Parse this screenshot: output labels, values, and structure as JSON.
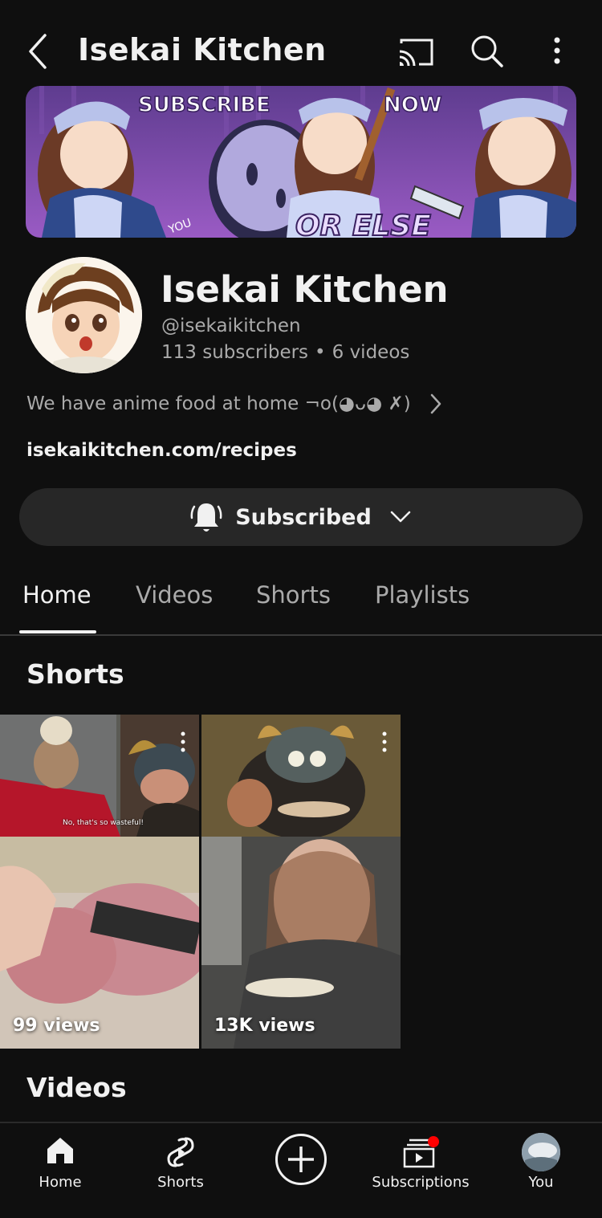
{
  "header": {
    "title": "Isekai Kitchen",
    "icons": [
      "back-icon",
      "cast-icon",
      "search-icon",
      "more-vert-icon"
    ]
  },
  "banner": {
    "text_left": "SUBSCRIBE",
    "text_right": "NOW",
    "text_bottom": "OR ELSE",
    "text_small": "YOU"
  },
  "channel": {
    "name": "Isekai Kitchen",
    "handle": "@isekaikitchen",
    "subscribers": "113 subscribers",
    "separator": "•",
    "videos": "6 videos",
    "description": "We have anime food at home   ¬o(◕ᴗ◕ ✗)",
    "link": "isekaikitchen.com/recipes"
  },
  "subscribe_button": {
    "label": "Subscribed",
    "icon": "bell-ringing-icon"
  },
  "tabs": [
    {
      "label": "Home",
      "active": true
    },
    {
      "label": "Videos",
      "active": false
    },
    {
      "label": "Shorts",
      "active": false
    },
    {
      "label": "Playlists",
      "active": false
    }
  ],
  "sections": {
    "shorts_title": "Shorts",
    "videos_title": "Videos"
  },
  "shorts": [
    {
      "views": "99 views",
      "caption": "No, that's so wasteful!"
    },
    {
      "views": "13K views",
      "caption": ""
    }
  ],
  "bottom_nav": [
    {
      "label": "Home",
      "icon": "home-icon"
    },
    {
      "label": "Shorts",
      "icon": "shorts-icon"
    },
    {
      "label": "",
      "icon": "create-plus-icon"
    },
    {
      "label": "Subscriptions",
      "icon": "subscriptions-icon"
    },
    {
      "label": "You",
      "icon": "user-avatar"
    }
  ],
  "colors": {
    "background": "#0f0f0f",
    "surface": "#272727",
    "text_primary": "#f1f1f1",
    "text_secondary": "#aaaaaa",
    "notification_dot": "#ff0000",
    "banner_purple": "#8a4fb8"
  }
}
